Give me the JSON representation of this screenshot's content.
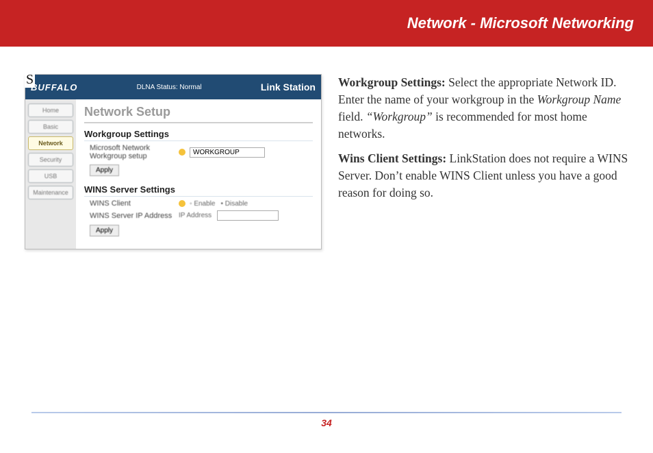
{
  "header": {
    "title": "Network - Microsoft Networking"
  },
  "overlay_letter": "S",
  "screenshot": {
    "logo": "BUFFALO",
    "status": "DLNA Status: Normal",
    "brand": "Link Station",
    "sidebar": {
      "items": [
        {
          "label": "Home"
        },
        {
          "label": "Basic"
        },
        {
          "label": "Network",
          "active": true
        },
        {
          "label": "Security"
        },
        {
          "label": "USB"
        },
        {
          "label": "Maintenance"
        }
      ]
    },
    "page_title": "Network Setup",
    "section1": {
      "heading": "Workgroup Settings",
      "row_label": "Microsoft Network Workgroup setup",
      "input_value": "WORKGROUP",
      "apply": "Apply"
    },
    "section2": {
      "heading": "WINS Server Settings",
      "row1_label": "WINS Client",
      "enable": "Enable",
      "disable": "Disable",
      "row2_label": "WINS Server IP Address",
      "ip_label": "IP Address",
      "apply": "Apply"
    }
  },
  "body": {
    "p1": {
      "bold": "Workgroup Settings:",
      "t1": "  Select the appropriate Network ID.  Enter the name of your workgroup in the ",
      "i1": "Workgroup Name",
      "t2": " field.  ",
      "i2": "“Workgroup”",
      "t3": " is recommended for most home networks."
    },
    "p2": {
      "bold": "Wins Client Settings:",
      "t1": "  LinkStation does not require a WINS Server.  Don’t enable WINS Client unless you have a good reason for doing so."
    }
  },
  "page_number": "34"
}
